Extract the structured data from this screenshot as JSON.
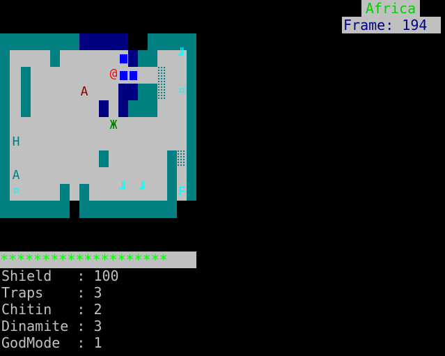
{
  "hud": {
    "level_name": "Africa",
    "frame_label": "Frame: 194"
  },
  "map": {
    "player": "@",
    "enemy_a": "A",
    "enemy_zh": "Ж",
    "letter_h": "H",
    "letter_a2": "A",
    "letter_f": "F",
    "item_gem": "¤",
    "item_gate": "╜╜",
    "item_gate_top": "╜"
  },
  "health_bar": {
    "text": "********************",
    "fill_fraction": 1.0
  },
  "stats": [
    {
      "text": "Shield   : 100"
    },
    {
      "text": "Traps    : 3"
    },
    {
      "text": "Chitin   : 2"
    },
    {
      "text": "Dinamite : 3"
    },
    {
      "text": "GodMode  : 1"
    }
  ],
  "colors": {
    "wall": "#008080",
    "floor": "#c0c0c0",
    "water": "#000080",
    "player": "#ff0000",
    "health": "#00ff00"
  }
}
